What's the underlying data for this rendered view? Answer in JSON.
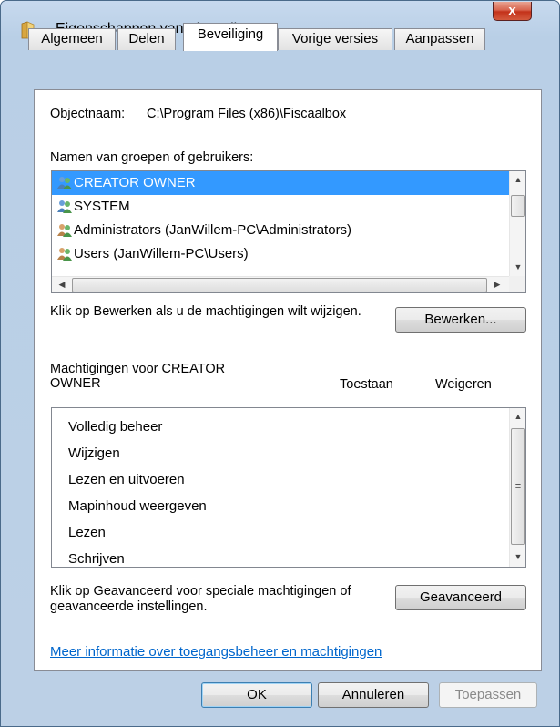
{
  "window": {
    "title": "Eigenschappen van Fiscaalbox",
    "close_label": "x"
  },
  "tabs": [
    {
      "label": "Algemeen"
    },
    {
      "label": "Delen"
    },
    {
      "label": "Beveiliging",
      "active": true
    },
    {
      "label": "Vorige versies"
    },
    {
      "label": "Aanpassen"
    }
  ],
  "object": {
    "label": "Objectnaam:",
    "value": "C:\\Program Files (x86)\\Fiscaalbox"
  },
  "groups": {
    "label": "Namen van groepen of gebruikers:",
    "items": [
      {
        "name": "CREATOR OWNER",
        "selected": true
      },
      {
        "name": "SYSTEM"
      },
      {
        "name": "Administrators (JanWillem-PC\\Administrators)"
      },
      {
        "name": "Users (JanWillem-PC\\Users)"
      }
    ]
  },
  "edit": {
    "description": "Klik op Bewerken als u de machtigingen wilt wijzigen.",
    "button": "Bewerken..."
  },
  "permissions": {
    "header": "Machtigingen voor CREATOR OWNER",
    "col_allow": "Toestaan",
    "col_deny": "Weigeren",
    "items": [
      {
        "name": "Volledig beheer"
      },
      {
        "name": "Wijzigen"
      },
      {
        "name": "Lezen en uitvoeren"
      },
      {
        "name": "Mapinhoud weergeven"
      },
      {
        "name": "Lezen"
      },
      {
        "name": "Schrijven"
      }
    ]
  },
  "advanced": {
    "description": "Klik op Geavanceerd voor speciale machtigingen of geavanceerde instellingen.",
    "button": "Geavanceerd"
  },
  "more_info_link": "Meer informatie over toegangsbeheer en machtigingen",
  "footer": {
    "ok": "OK",
    "cancel": "Annuleren",
    "apply": "Toepassen"
  }
}
